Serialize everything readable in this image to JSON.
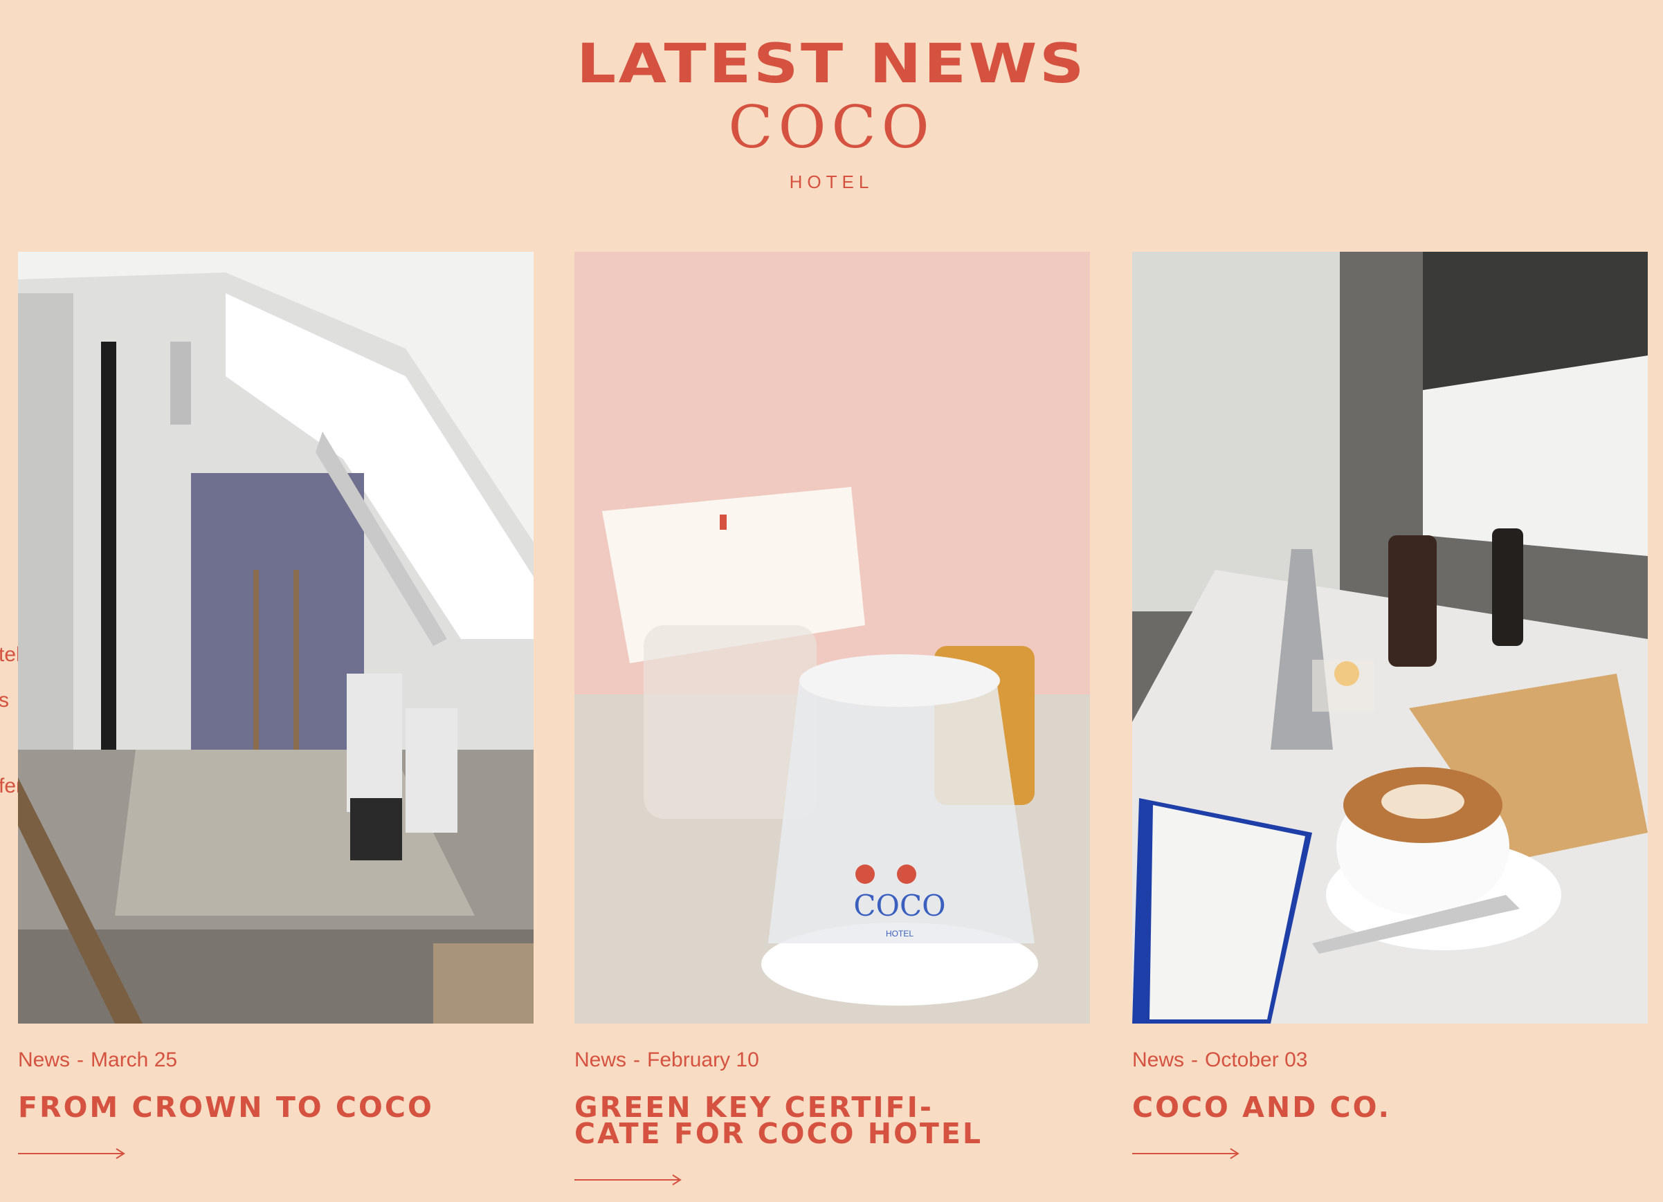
{
  "header": {
    "title": "LATEST NEWS",
    "logo_word": "COCO",
    "logo_sub": "HOTEL"
  },
  "side_menu": {
    "items": [
      "tel",
      "s",
      "ferences"
    ]
  },
  "cards": [
    {
      "category": "News",
      "separator": "-",
      "date": "March 25",
      "title": "FROM CROWN TO COCO",
      "image": "attic-renovation-photo"
    },
    {
      "category": "News",
      "separator": "-",
      "date": "February 10",
      "title_line1": "GREEN KEY CERTIFI-",
      "title_line2": "CATE FOR COCO HOTEL",
      "image": "water-glass-card-photo"
    },
    {
      "category": "News",
      "separator": "-",
      "date": "October 03",
      "title": "COCO AND CO.",
      "image": "cafe-latte-photo"
    }
  ],
  "colors": {
    "background": "#f9dcc4",
    "accent": "#d4523f"
  }
}
